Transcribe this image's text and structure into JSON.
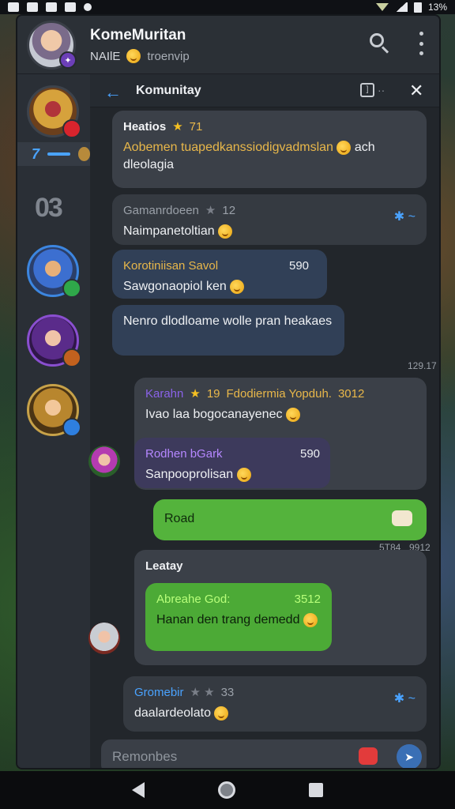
{
  "statusbar": {
    "battery_text": "13%"
  },
  "header": {
    "title": "KomeMuritan",
    "name_tag": "NAIlE",
    "sub_text": "troenvip"
  },
  "subheader": {
    "title": "Komunitay"
  },
  "messages": [
    {
      "sender": "Heatios",
      "rating": "71",
      "text": "Aobemen tuapedkanssiodigvadmslan",
      "text_tail": "ach dleolagia"
    },
    {
      "sender": "Gamanrdoeen",
      "rating": "12",
      "text": "Naimpanetoltian"
    },
    {
      "sender": "Korotiniisan Savol",
      "count": "590",
      "text": "Sawgonaopiol ken"
    },
    {
      "text": "Nenro dlodloame wolle pran heakaes",
      "time": "129.17"
    },
    {
      "sender": "Karahn",
      "rating": "19",
      "group": "Fdodiermia Yopduh.",
      "number": "3012",
      "text": "Ivao laa bogocanayenec"
    },
    {
      "sender": "Rodhen bGark",
      "count": "590",
      "text": "Sanpooprolisan"
    },
    {
      "text": "Road",
      "time_a": "5T84",
      "time_b": "9912"
    },
    {
      "sender": "Leatay",
      "reply_name": "Abreahe God:",
      "reply_num": "3512",
      "text": "Hanan den trang demedd"
    },
    {
      "sender": "Gromebir",
      "rating": "33",
      "text": "daalardeolato"
    }
  ],
  "composer": {
    "placeholder": "Remonbes"
  },
  "rail": {
    "chip_number": "7",
    "mark": "03"
  },
  "colors": {
    "accent": "#4aa3ff",
    "green_bubble": "#54b33c",
    "panel": "#262a30"
  },
  "icons": [
    "search-icon",
    "more-icon",
    "back-arrow-icon",
    "expand-icon",
    "close-icon",
    "sticker-icon",
    "send-icon",
    "exit-icon"
  ]
}
